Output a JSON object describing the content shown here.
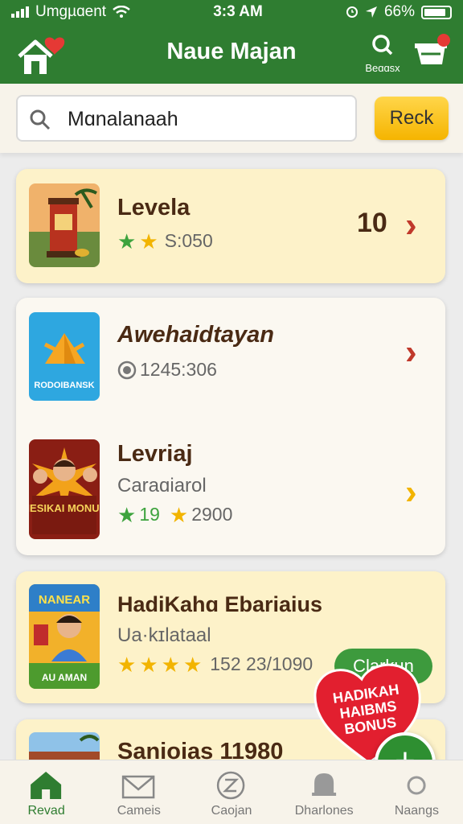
{
  "status": {
    "carrier": "Umgµɑent",
    "time": "3:3 AM",
    "battery": "66%"
  },
  "header": {
    "title": "Naue Majan",
    "search_label": "Beɑɑsx"
  },
  "search": {
    "value": "Mɑnalanaah",
    "button_label": "Reck"
  },
  "cards": [
    {
      "name": "Levela",
      "rating_text": "S:050",
      "price": "10"
    },
    {
      "name": "Awehaidtayan",
      "meta_text": "1245:306",
      "thumb_label": "RODOIBANSK"
    },
    {
      "name": "Levriaj",
      "subtitle": "Caraɑiarol",
      "rating_count": "19",
      "rating_text": "2900",
      "thumb_label": "HESIKAI MONUS"
    },
    {
      "name": "HadiKahɑ Ebariaius",
      "subtitle": "Ua·kɪlataal",
      "rating_text": "152 23/1090",
      "claim_label": "Clarkun",
      "thumb_label_top": "NANEAR",
      "thumb_label_bottom": "AU AMAN"
    },
    {
      "name": "Sanioias 11980"
    }
  ],
  "promo": {
    "text": "HADIKAH HAIBMS BONUS"
  },
  "fab": {
    "label": "+"
  },
  "nav": [
    {
      "label": "Revad",
      "icon": "home-icon"
    },
    {
      "label": "Cameis",
      "icon": "mail-icon"
    },
    {
      "label": "Caojan",
      "icon": "coupon-icon"
    },
    {
      "label": "Dharlones",
      "icon": "bell-icon"
    },
    {
      "label": "Naangs",
      "icon": "settings-icon"
    }
  ],
  "colors": {
    "primary_green": "#2f7d31",
    "accent_yellow": "#f5b400",
    "chevron_red": "#c0392b",
    "chevron_yellow": "#f2b400"
  }
}
